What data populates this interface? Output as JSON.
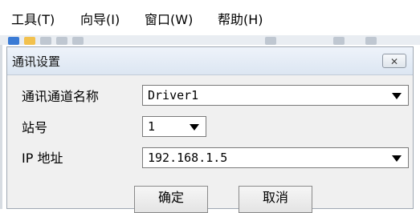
{
  "menu": {
    "items": [
      {
        "label": "工具(T)"
      },
      {
        "label": "向导(I)"
      },
      {
        "label": "窗口(W)"
      },
      {
        "label": "帮助(H)"
      }
    ]
  },
  "dialog": {
    "title": "通讯设置",
    "close_icon": "close-icon",
    "fields": {
      "channel": {
        "label": "通讯通道名称",
        "value": "Driver1"
      },
      "station": {
        "label": "站号",
        "value": "1"
      },
      "ip": {
        "label": "IP 地址",
        "value": "192.168.1.5"
      }
    },
    "buttons": {
      "ok": "确定",
      "cancel": "取消"
    }
  },
  "colors": {
    "title_bar": "#dce6f2",
    "dialog_bg": "#f0f0f0"
  }
}
